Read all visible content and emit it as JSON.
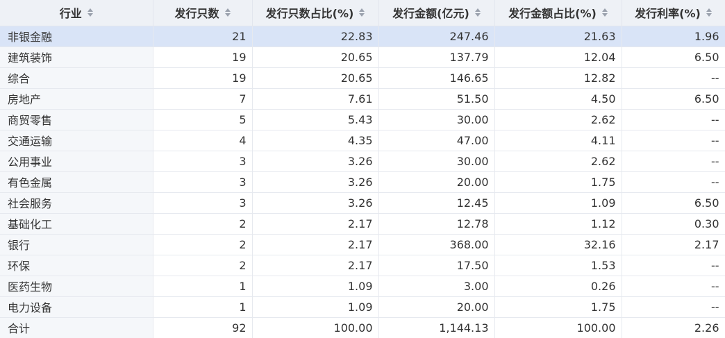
{
  "table": {
    "headers": [
      "行业",
      "发行只数",
      "发行只数占比(%)",
      "发行金额(亿元)",
      "发行金额占比(%)",
      "发行利率(%)"
    ],
    "rows": [
      [
        "非银金融",
        "21",
        "22.83",
        "247.46",
        "21.63",
        "1.96"
      ],
      [
        "建筑装饰",
        "19",
        "20.65",
        "137.79",
        "12.04",
        "6.50"
      ],
      [
        "综合",
        "19",
        "20.65",
        "146.65",
        "12.82",
        "--"
      ],
      [
        "房地产",
        "7",
        "7.61",
        "51.50",
        "4.50",
        "6.50"
      ],
      [
        "商贸零售",
        "5",
        "5.43",
        "30.00",
        "2.62",
        "--"
      ],
      [
        "交通运输",
        "4",
        "4.35",
        "47.00",
        "4.11",
        "--"
      ],
      [
        "公用事业",
        "3",
        "3.26",
        "30.00",
        "2.62",
        "--"
      ],
      [
        "有色金属",
        "3",
        "3.26",
        "20.00",
        "1.75",
        "--"
      ],
      [
        "社会服务",
        "3",
        "3.26",
        "12.45",
        "1.09",
        "6.50"
      ],
      [
        "基础化工",
        "2",
        "2.17",
        "12.78",
        "1.12",
        "0.30"
      ],
      [
        "银行",
        "2",
        "2.17",
        "368.00",
        "32.16",
        "2.17"
      ],
      [
        "环保",
        "2",
        "2.17",
        "17.50",
        "1.53",
        "--"
      ],
      [
        "医药生物",
        "1",
        "1.09",
        "3.00",
        "0.26",
        "--"
      ],
      [
        "电力设备",
        "1",
        "1.09",
        "20.00",
        "1.75",
        "--"
      ]
    ],
    "total": [
      "合计",
      "92",
      "100.00",
      "1,144.13",
      "100.00",
      "2.26"
    ],
    "selected_row": 0
  },
  "icons": {
    "sort": "sort-icon"
  },
  "colors": {
    "header_bg": "#eef1f6",
    "selected_row_bg": "#d9e4f7",
    "first_col_bg": "#f5f7fa",
    "border": "#e6e9ef",
    "text": "#333333",
    "sort_icon": "#9aa1ad"
  }
}
